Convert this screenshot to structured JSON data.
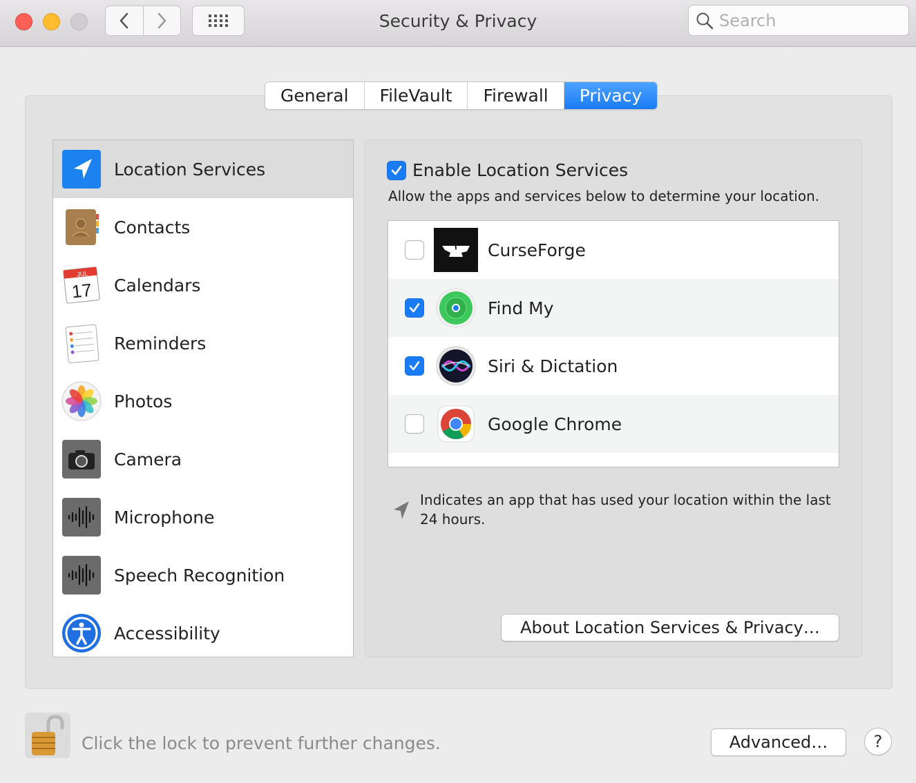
{
  "window": {
    "title": "Security & Privacy",
    "search_placeholder": "Search"
  },
  "tabs": [
    {
      "label": "General",
      "active": false
    },
    {
      "label": "FileVault",
      "active": false
    },
    {
      "label": "Firewall",
      "active": false
    },
    {
      "label": "Privacy",
      "active": true
    }
  ],
  "sidebar": {
    "items": [
      {
        "label": "Location Services",
        "icon": "location-arrow-icon",
        "selected": true
      },
      {
        "label": "Contacts",
        "icon": "contacts-book-icon"
      },
      {
        "label": "Calendars",
        "icon": "calendar-icon",
        "month": "JUL",
        "day": "17"
      },
      {
        "label": "Reminders",
        "icon": "reminders-icon"
      },
      {
        "label": "Photos",
        "icon": "photos-flower-icon"
      },
      {
        "label": "Camera",
        "icon": "camera-icon"
      },
      {
        "label": "Microphone",
        "icon": "microphone-waveform-icon"
      },
      {
        "label": "Speech Recognition",
        "icon": "speech-waveform-icon"
      },
      {
        "label": "Accessibility",
        "icon": "accessibility-icon"
      }
    ]
  },
  "location": {
    "enable_label": "Enable Location Services",
    "enabled": true,
    "description": "Allow the apps and services below to determine your location.",
    "apps": [
      {
        "label": "CurseForge",
        "checked": false,
        "icon": "curseforge-anvil-icon"
      },
      {
        "label": "Find My",
        "checked": true,
        "icon": "find-my-icon"
      },
      {
        "label": "Siri & Dictation",
        "checked": true,
        "icon": "siri-icon"
      },
      {
        "label": "Google Chrome",
        "checked": false,
        "icon": "chrome-icon"
      }
    ],
    "legend": "Indicates an app that has used your location within the last 24 hours.",
    "about_button": "About Location Services & Privacy…"
  },
  "footer": {
    "lock_text": "Click the lock to prevent further changes.",
    "advanced_button": "Advanced…",
    "help_button": "?"
  },
  "colors": {
    "accent": "#1a7cf5",
    "close": "#fe5f57",
    "minimize": "#febc2e"
  }
}
